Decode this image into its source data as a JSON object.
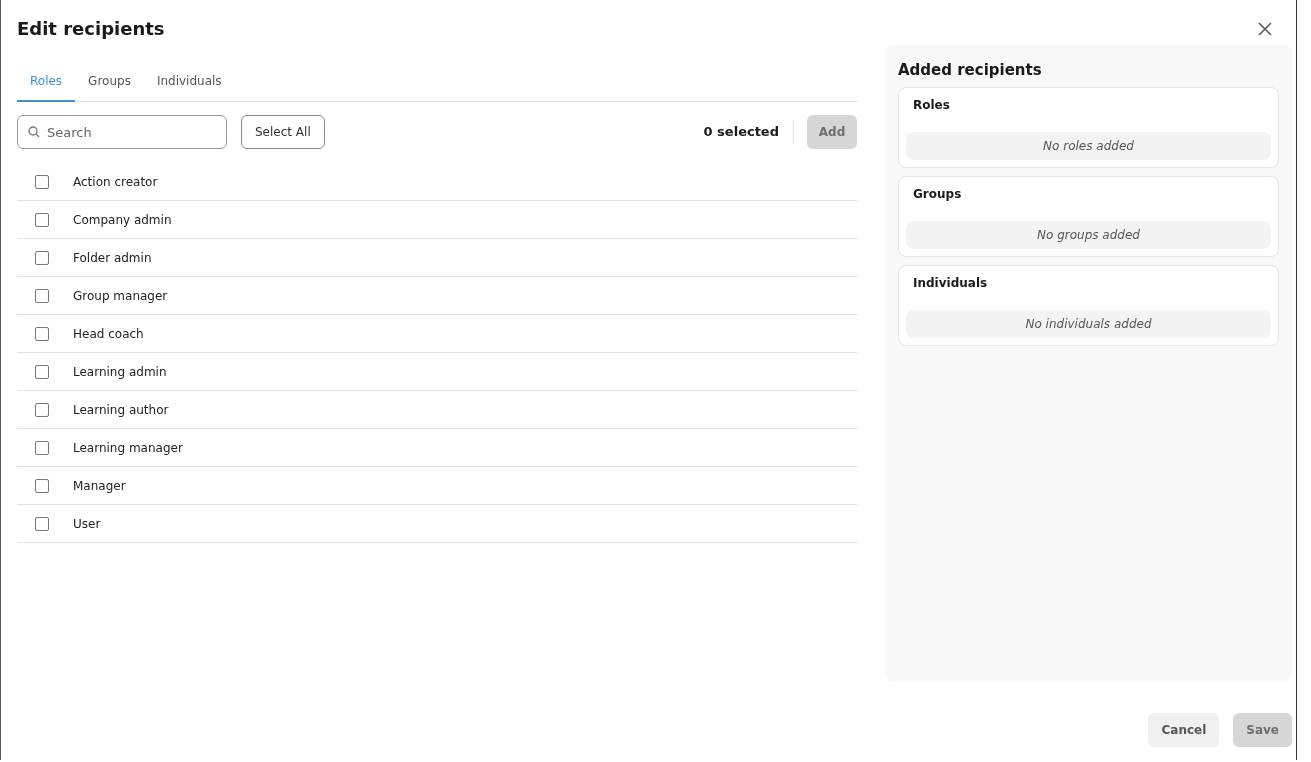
{
  "dialog": {
    "title": "Edit recipients"
  },
  "tabs": [
    {
      "label": "Roles",
      "selected": true
    },
    {
      "label": "Groups",
      "selected": false
    },
    {
      "label": "Individuals",
      "selected": false
    }
  ],
  "search": {
    "placeholder": "Search"
  },
  "select_all": "Select All",
  "selected_count": "0 selected",
  "add_button": {
    "label": "Add",
    "disabled": true
  },
  "items": [
    {
      "label": "Action creator",
      "checked": false
    },
    {
      "label": "Company admin",
      "checked": false
    },
    {
      "label": "Folder admin",
      "checked": false
    },
    {
      "label": "Group manager",
      "checked": false
    },
    {
      "label": "Head coach",
      "checked": false
    },
    {
      "label": "Learning admin",
      "checked": false
    },
    {
      "label": "Learning author",
      "checked": false
    },
    {
      "label": "Learning manager",
      "checked": false
    },
    {
      "label": "Manager",
      "checked": false
    },
    {
      "label": "User",
      "checked": false
    }
  ],
  "added": {
    "title": "Added recipients",
    "sections": [
      {
        "title": "Roles",
        "empty": "No roles added"
      },
      {
        "title": "Groups",
        "empty": "No groups added"
      },
      {
        "title": "Individuals",
        "empty": "No individuals added"
      }
    ]
  },
  "footer": {
    "cancel": {
      "label": "Cancel",
      "disabled": false
    },
    "save": {
      "label": "Save",
      "disabled": true
    }
  }
}
